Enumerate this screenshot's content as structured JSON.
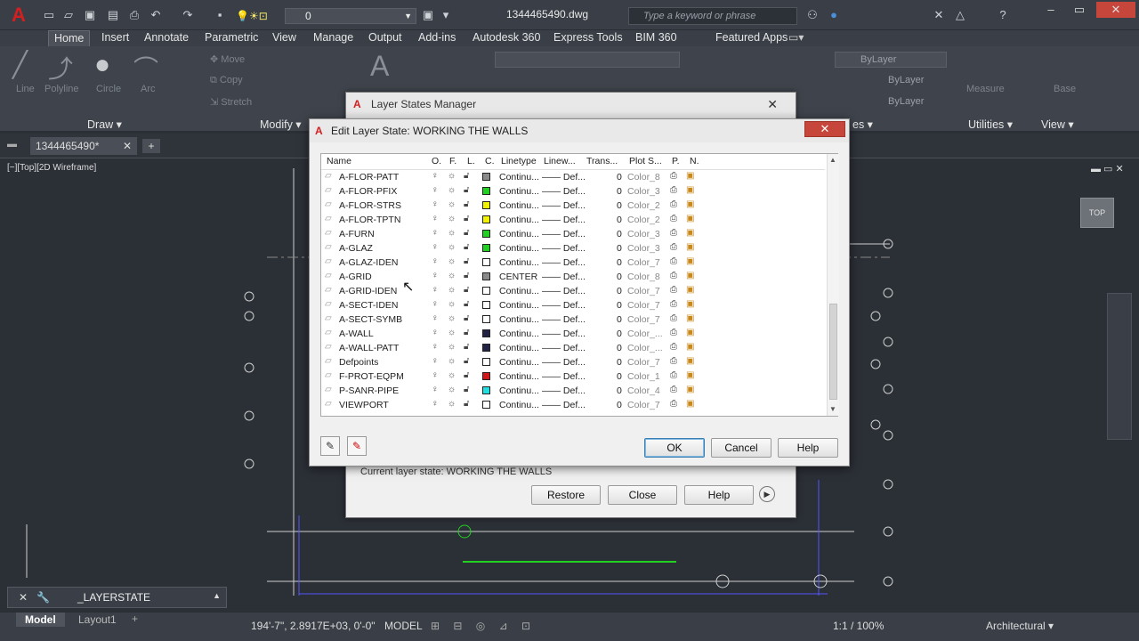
{
  "titlebar": {
    "app_icon": "autocad-logo-icon",
    "current_layer": "0",
    "document_title": "1344465490.dwg",
    "search_placeholder": "Type a keyword or phrase"
  },
  "ribbon_tabs": [
    "Home",
    "Insert",
    "Annotate",
    "Parametric",
    "View",
    "Manage",
    "Output",
    "Add-ins",
    "Autodesk 360",
    "Express Tools",
    "BIM 360",
    "Featured Apps"
  ],
  "ribbon": {
    "draw_labels": [
      "Line",
      "Polyline",
      "Circle",
      "Arc"
    ],
    "modify_labels": [
      "Move",
      "Copy",
      "Stretch"
    ],
    "panels": [
      "Draw",
      "Modify",
      "es",
      "Utilities",
      "View"
    ],
    "properties": [
      "ByLayer",
      "ByLayer",
      "ByLayer"
    ],
    "measure_label": "Measure",
    "base_label": "Base"
  },
  "file_tab": {
    "name": "1344465490*"
  },
  "viewport": {
    "label": "[−][Top][2D Wireframe]",
    "viewcube": "TOP"
  },
  "command_line": {
    "prompt": "_LAYERSTATE"
  },
  "layout_tabs": [
    "Model",
    "Layout1"
  ],
  "status": {
    "coords": "194'-7\", 2.8917E+03, 0'-0\"",
    "model": "MODEL",
    "scale": "1:1 / 100%",
    "workspace": "Architectural"
  },
  "layer_states_manager": {
    "title": "Layer States Manager",
    "current_state": "Current layer state: WORKING THE WALLS",
    "buttons": [
      "Restore",
      "Close",
      "Help"
    ]
  },
  "edit_layer_state": {
    "title": "Edit Layer State: WORKING THE WALLS",
    "columns": [
      "Name",
      "O.",
      "F.",
      "L.",
      "C.",
      "Linetype",
      "Linew...",
      "Trans...",
      "Plot S...",
      "P.",
      "N."
    ],
    "rows": [
      {
        "name": "A-FLOR-PATT",
        "color": "#8a8a8a",
        "linetype": "Continu...",
        "lineweight": "—— Def...",
        "trans": "0",
        "plot": "Color_8"
      },
      {
        "name": "A-FLOR-PFIX",
        "color": "#22d022",
        "linetype": "Continu...",
        "lineweight": "—— Def...",
        "trans": "0",
        "plot": "Color_3"
      },
      {
        "name": "A-FLOR-STRS",
        "color": "#f2f200",
        "linetype": "Continu...",
        "lineweight": "—— Def...",
        "trans": "0",
        "plot": "Color_2"
      },
      {
        "name": "A-FLOR-TPTN",
        "color": "#f2f200",
        "linetype": "Continu...",
        "lineweight": "—— Def...",
        "trans": "0",
        "plot": "Color_2"
      },
      {
        "name": "A-FURN",
        "color": "#22d022",
        "linetype": "Continu...",
        "lineweight": "—— Def...",
        "trans": "0",
        "plot": "Color_3"
      },
      {
        "name": "A-GLAZ",
        "color": "#22d022",
        "linetype": "Continu...",
        "lineweight": "—— Def...",
        "trans": "0",
        "plot": "Color_3"
      },
      {
        "name": "A-GLAZ-IDEN",
        "color": "#ffffff",
        "linetype": "Continu...",
        "lineweight": "—— Def...",
        "trans": "0",
        "plot": "Color_7"
      },
      {
        "name": "A-GRID",
        "color": "#8a8a8a",
        "linetype": "CENTER",
        "lineweight": "—— Def...",
        "trans": "0",
        "plot": "Color_8"
      },
      {
        "name": "A-GRID-IDEN",
        "color": "#ffffff",
        "linetype": "Continu...",
        "lineweight": "—— Def...",
        "trans": "0",
        "plot": "Color_7"
      },
      {
        "name": "A-SECT-IDEN",
        "color": "#ffffff",
        "linetype": "Continu...",
        "lineweight": "—— Def...",
        "trans": "0",
        "plot": "Color_7"
      },
      {
        "name": "A-SECT-SYMB",
        "color": "#ffffff",
        "linetype": "Continu...",
        "lineweight": "—— Def...",
        "trans": "0",
        "plot": "Color_7"
      },
      {
        "name": "A-WALL",
        "color": "#222244",
        "linetype": "Continu...",
        "lineweight": "—— Def...",
        "trans": "0",
        "plot": "Color_..."
      },
      {
        "name": "A-WALL-PATT",
        "color": "#222244",
        "linetype": "Continu...",
        "lineweight": "—— Def...",
        "trans": "0",
        "plot": "Color_..."
      },
      {
        "name": "Defpoints",
        "color": "#ffffff",
        "linetype": "Continu...",
        "lineweight": "—— Def...",
        "trans": "0",
        "plot": "Color_7"
      },
      {
        "name": "F-PROT-EQPM",
        "color": "#d01818",
        "linetype": "Continu...",
        "lineweight": "—— Def...",
        "trans": "0",
        "plot": "Color_1"
      },
      {
        "name": "P-SANR-PIPE",
        "color": "#22dede",
        "linetype": "Continu...",
        "lineweight": "—— Def...",
        "trans": "0",
        "plot": "Color_4"
      },
      {
        "name": "VIEWPORT",
        "color": "#ffffff",
        "linetype": "Continu...",
        "lineweight": "—— Def...",
        "trans": "0",
        "plot": "Color_7"
      }
    ],
    "buttons": {
      "ok": "OK",
      "cancel": "Cancel",
      "help": "Help"
    }
  }
}
